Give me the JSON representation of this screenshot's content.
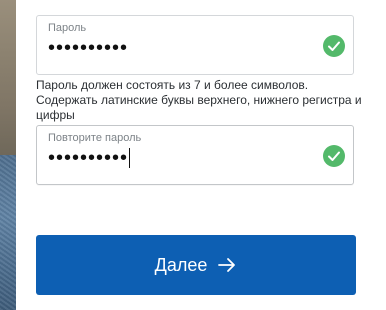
{
  "form": {
    "password": {
      "label": "Пароль",
      "value": "••••••••••",
      "status_icon": "check-circle-icon"
    },
    "hint": "Пароль должен состоять из 7 и более символов. Содержать латинские буквы верхнего, нижнего регистра и цифры",
    "repeat_password": {
      "label": "Повторите пароль",
      "value": "••••••••••",
      "status_icon": "check-circle-icon"
    },
    "next_button": {
      "label": "Далее",
      "icon": "arrow-right-icon"
    }
  },
  "colors": {
    "accent": "#0d5fb3",
    "success": "#53b96a"
  }
}
